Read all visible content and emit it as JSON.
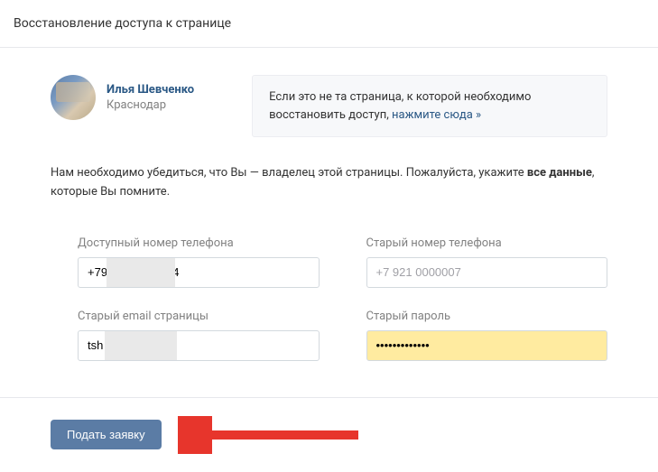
{
  "page": {
    "title": "Восстановление доступа к странице"
  },
  "user": {
    "name": "Илья Шевченко",
    "city": "Краснодар"
  },
  "notice": {
    "text_prefix": "Если это не та страница, к которой необходимо восстановить доступ, ",
    "link_text": "нажмите сюда »"
  },
  "instruction": {
    "part1": "Нам необходимо убедиться, что Вы — владелец этой страницы. Пожалуйста, укажите ",
    "bold": "все данные",
    "part2": ", которые Вы помните."
  },
  "form": {
    "available_phone": {
      "label": "Доступный номер телефона",
      "value": "+79                    4"
    },
    "old_phone": {
      "label": "Старый номер телефона",
      "placeholder": "+7 921 0000007"
    },
    "old_email": {
      "label": "Старый email страницы",
      "value": "tsh                  ru"
    },
    "old_password": {
      "label": "Старый пароль",
      "value": "•••••••••••••"
    }
  },
  "submit": {
    "label": "Подать заявку"
  }
}
